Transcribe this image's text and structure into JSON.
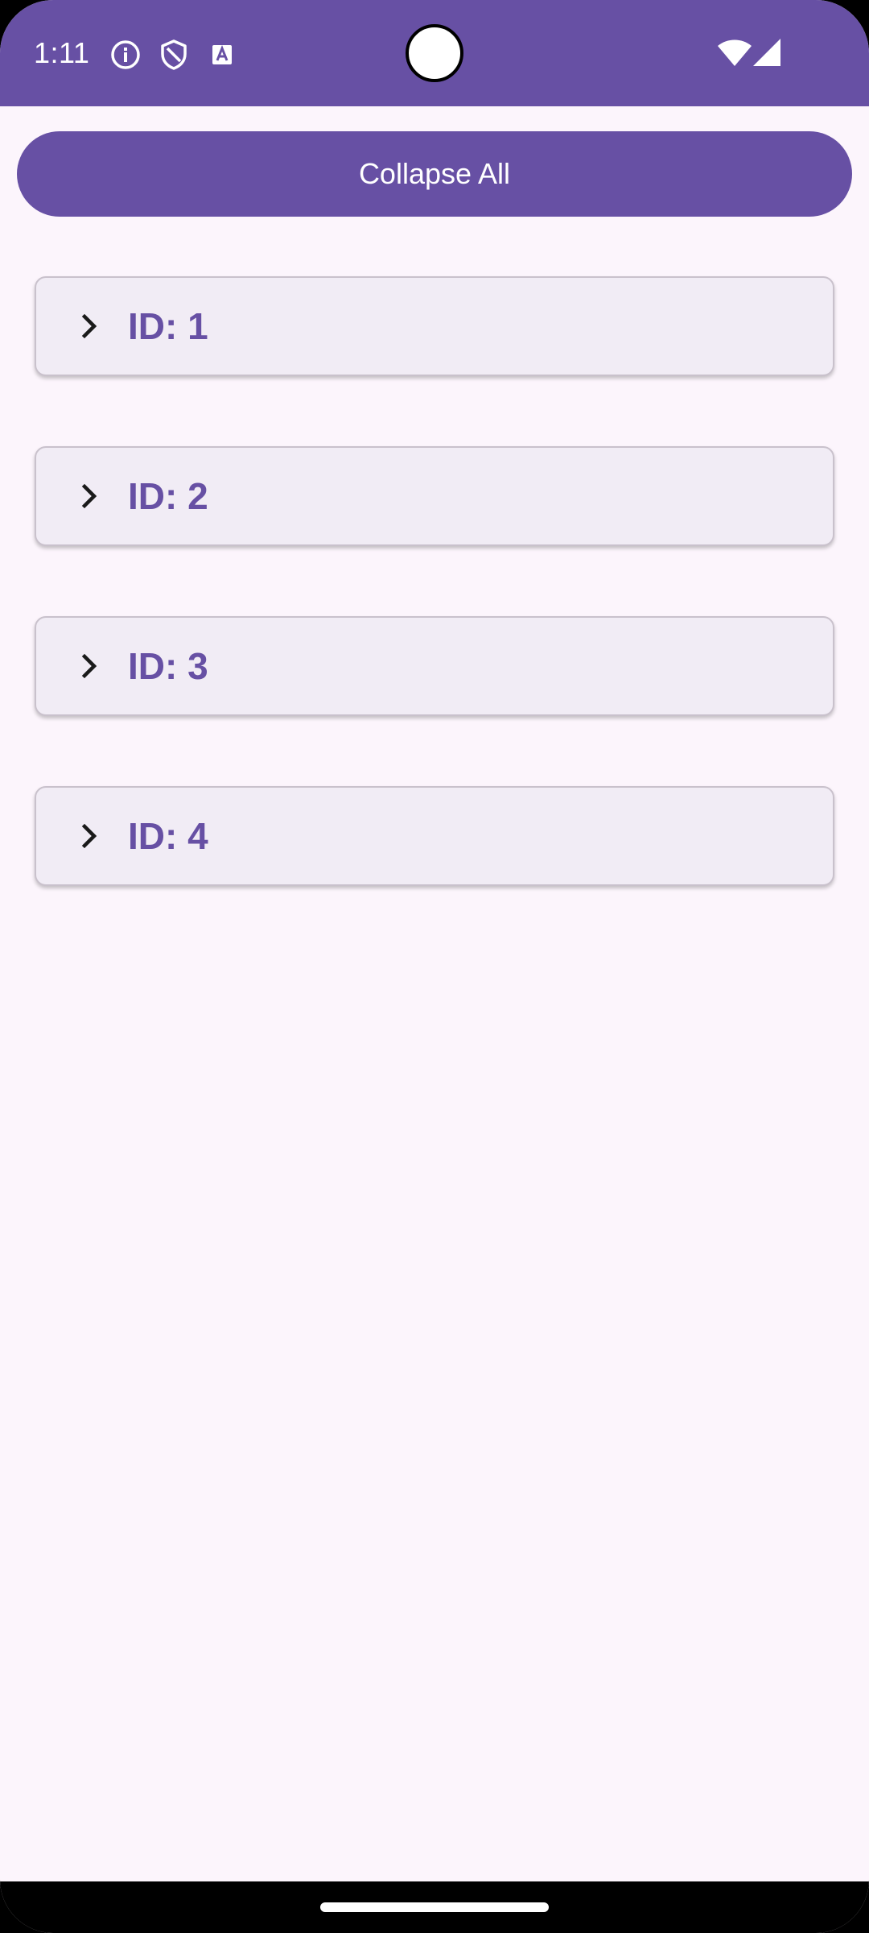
{
  "status_bar": {
    "time": "1:11",
    "background_color": "#6750A4",
    "icons": [
      "info-icon",
      "shield-icon",
      "text-a-icon",
      "wifi-icon",
      "signal-icon"
    ]
  },
  "collapse_button": {
    "label": "Collapse All",
    "color": "#6750A4"
  },
  "items": [
    {
      "label": "ID: 1",
      "icon": "chevron-right-icon"
    },
    {
      "label": "ID: 2",
      "icon": "chevron-right-icon"
    },
    {
      "label": "ID: 3",
      "icon": "chevron-right-icon"
    },
    {
      "label": "ID: 4",
      "icon": "chevron-right-icon"
    }
  ],
  "colors": {
    "accent": "#6750A4",
    "background": "#FCF5FC",
    "card": "#F1ECF5"
  }
}
